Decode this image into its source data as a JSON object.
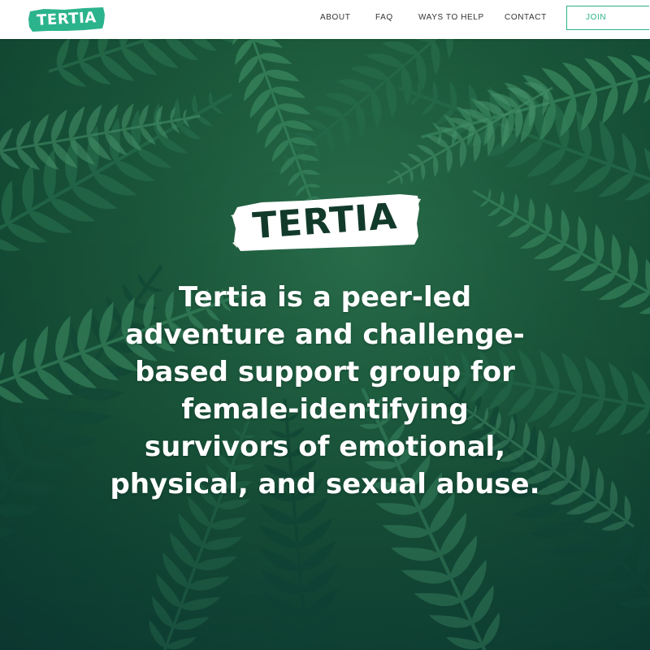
{
  "nav": {
    "logo_text": "TERTIA",
    "links": [
      {
        "label": "ABOUT"
      },
      {
        "label": "FAQ"
      },
      {
        "label": "WAYS TO HELP"
      },
      {
        "label": "CONTACT"
      }
    ],
    "join_label": "JOIN"
  },
  "hero": {
    "logo_text": "TERTIA",
    "tagline": "Tertia is a peer-led adventure and challenge-based support group for female-identifying survivors of emotional, physical, and sexual abuse."
  },
  "colors": {
    "brand_teal": "#2bb38c",
    "hero_green": "#1d5c3d",
    "logo_dark": "#123a2a"
  }
}
